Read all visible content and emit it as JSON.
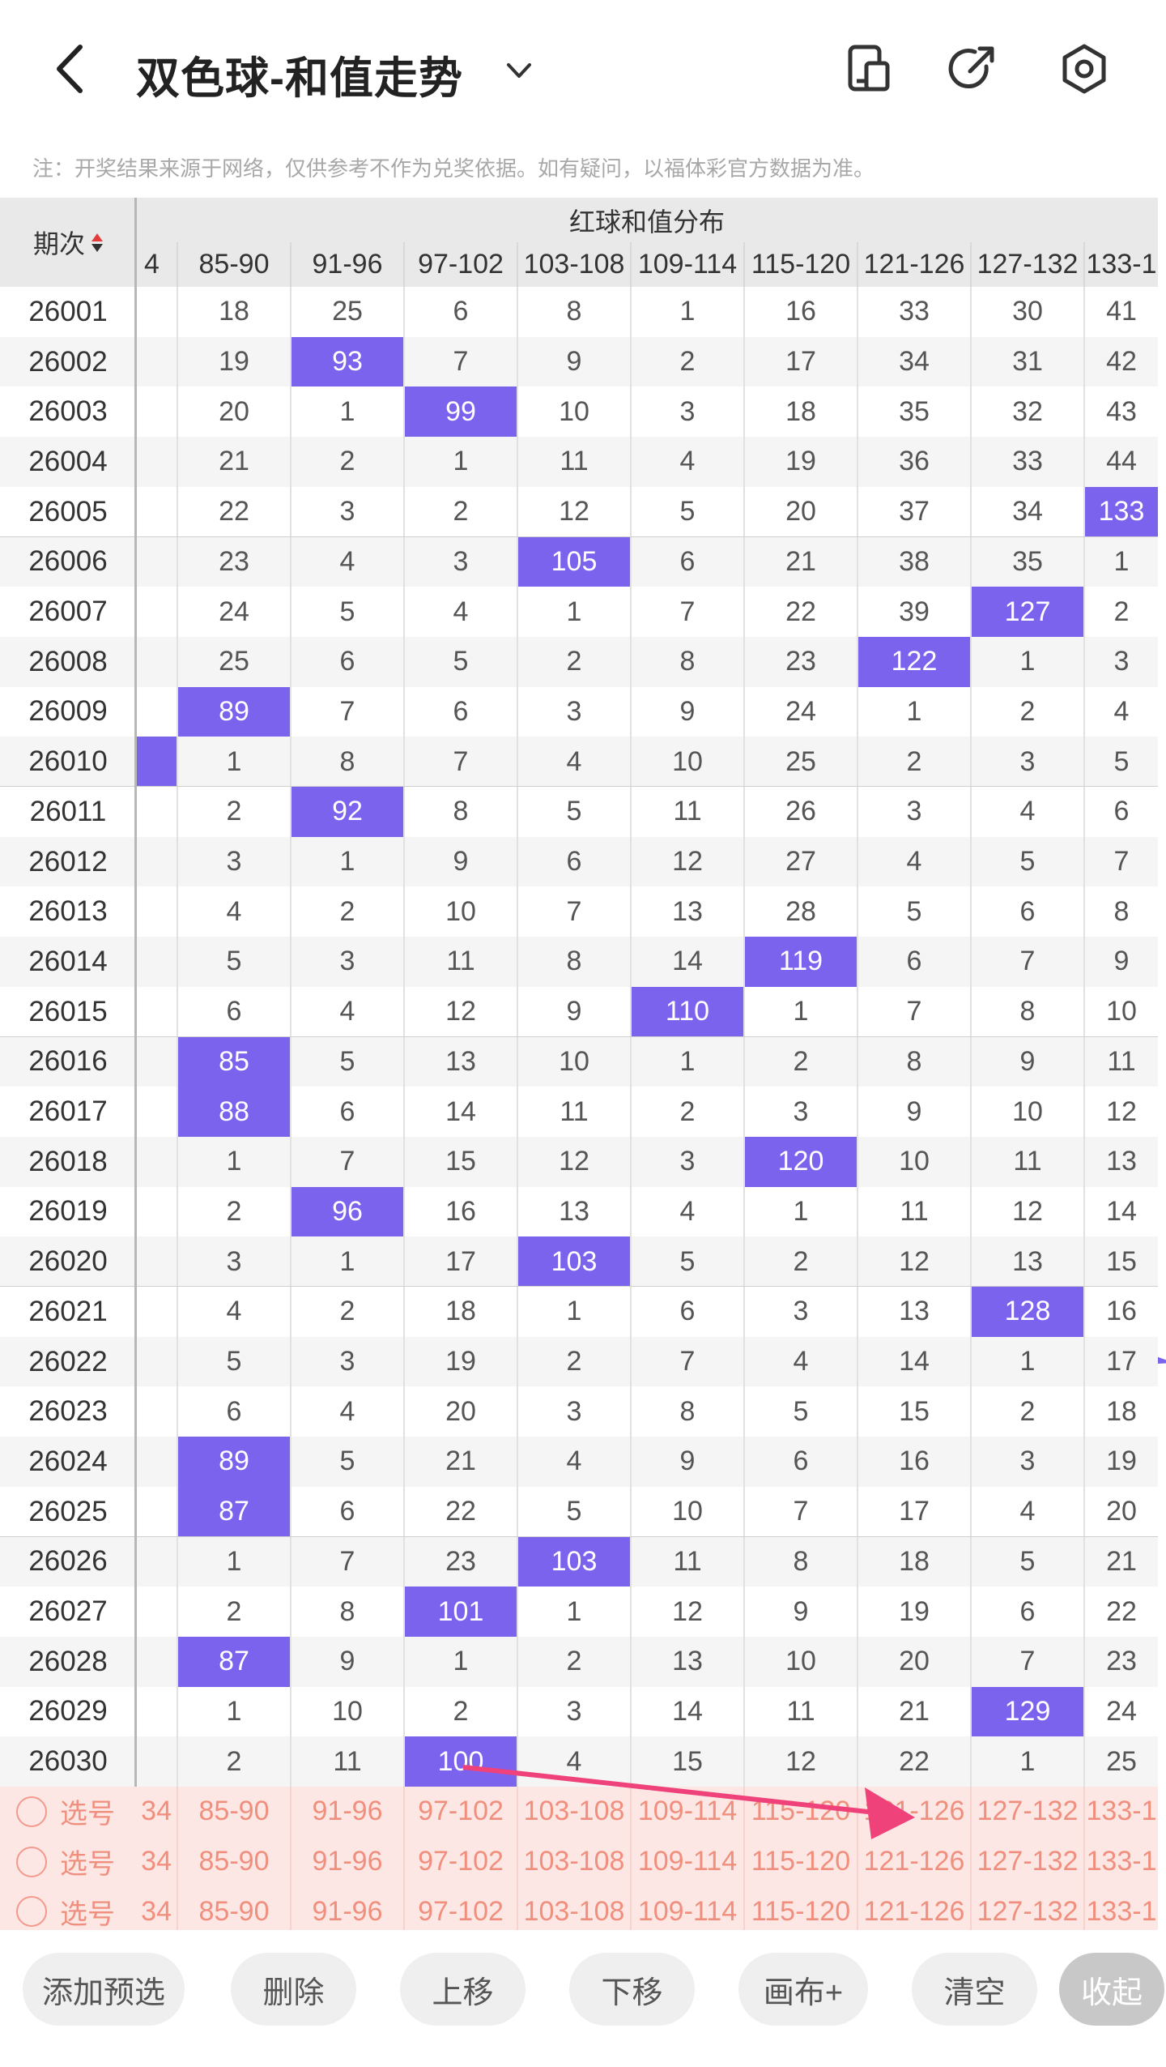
{
  "header": {
    "title": "双色球-和值走势",
    "back_icon": "back-chevron-icon",
    "caret_icon": "chevron-down-icon",
    "icons": [
      "phone-layout-icon",
      "share-icon",
      "settings-icon"
    ]
  },
  "notice": "注：开奖结果来源于网络，仅供参考不作为兑奖依据。如有疑问，以福体彩官方数据为准。",
  "table": {
    "period_header": "期次",
    "group_title": "红球和值分布",
    "columns": [
      "4",
      "85-90",
      "91-96",
      "97-102",
      "103-108",
      "109-114",
      "115-120",
      "121-126",
      "127-132",
      "133-1"
    ],
    "rows": [
      {
        "period": "26001",
        "cells": [
          "",
          "18",
          "25",
          "6",
          "8",
          "1",
          "16",
          "33",
          "30",
          "41"
        ]
      },
      {
        "period": "26002",
        "cells": [
          "",
          "19",
          "93",
          "7",
          "9",
          "2",
          "17",
          "34",
          "31",
          "42"
        ]
      },
      {
        "period": "26003",
        "cells": [
          "",
          "20",
          "1",
          "99",
          "10",
          "3",
          "18",
          "35",
          "32",
          "43"
        ]
      },
      {
        "period": "26004",
        "cells": [
          "",
          "21",
          "2",
          "1",
          "11",
          "4",
          "19",
          "36",
          "33",
          "44"
        ]
      },
      {
        "period": "26005",
        "cells": [
          "",
          "22",
          "3",
          "2",
          "12",
          "5",
          "20",
          "37",
          "34",
          "133"
        ]
      },
      {
        "period": "26006",
        "cells": [
          "",
          "23",
          "4",
          "3",
          "105",
          "6",
          "21",
          "38",
          "35",
          "1"
        ]
      },
      {
        "period": "26007",
        "cells": [
          "",
          "24",
          "5",
          "4",
          "1",
          "7",
          "22",
          "39",
          "127",
          "2"
        ]
      },
      {
        "period": "26008",
        "cells": [
          "",
          "25",
          "6",
          "5",
          "2",
          "8",
          "23",
          "122",
          "1",
          "3"
        ]
      },
      {
        "period": "26009",
        "cells": [
          "",
          "89",
          "7",
          "6",
          "3",
          "9",
          "24",
          "1",
          "2",
          "4"
        ]
      },
      {
        "period": "26010",
        "cells": [
          "",
          "1",
          "8",
          "7",
          "4",
          "10",
          "25",
          "2",
          "3",
          "5"
        ]
      },
      {
        "period": "26011",
        "cells": [
          "",
          "2",
          "92",
          "8",
          "5",
          "11",
          "26",
          "3",
          "4",
          "6"
        ]
      },
      {
        "period": "26012",
        "cells": [
          "",
          "3",
          "1",
          "9",
          "6",
          "12",
          "27",
          "4",
          "5",
          "7"
        ]
      },
      {
        "period": "26013",
        "cells": [
          "",
          "4",
          "2",
          "10",
          "7",
          "13",
          "28",
          "5",
          "6",
          "8"
        ]
      },
      {
        "period": "26014",
        "cells": [
          "",
          "5",
          "3",
          "11",
          "8",
          "14",
          "119",
          "6",
          "7",
          "9"
        ]
      },
      {
        "period": "26015",
        "cells": [
          "",
          "6",
          "4",
          "12",
          "9",
          "110",
          "1",
          "7",
          "8",
          "10"
        ]
      },
      {
        "period": "26016",
        "cells": [
          "",
          "85",
          "5",
          "13",
          "10",
          "1",
          "2",
          "8",
          "9",
          "11"
        ]
      },
      {
        "period": "26017",
        "cells": [
          "",
          "88",
          "6",
          "14",
          "11",
          "2",
          "3",
          "9",
          "10",
          "12"
        ]
      },
      {
        "period": "26018",
        "cells": [
          "",
          "1",
          "7",
          "15",
          "12",
          "3",
          "120",
          "10",
          "11",
          "13"
        ]
      },
      {
        "period": "26019",
        "cells": [
          "",
          "2",
          "96",
          "16",
          "13",
          "4",
          "1",
          "11",
          "12",
          "14"
        ]
      },
      {
        "period": "26020",
        "cells": [
          "",
          "3",
          "1",
          "17",
          "103",
          "5",
          "2",
          "12",
          "13",
          "15"
        ]
      },
      {
        "period": "26021",
        "cells": [
          "",
          "4",
          "2",
          "18",
          "1",
          "6",
          "3",
          "13",
          "128",
          "16"
        ]
      },
      {
        "period": "26022",
        "cells": [
          "",
          "5",
          "3",
          "19",
          "2",
          "7",
          "4",
          "14",
          "1",
          "17"
        ]
      },
      {
        "period": "26023",
        "cells": [
          "",
          "6",
          "4",
          "20",
          "3",
          "8",
          "5",
          "15",
          "2",
          "18"
        ]
      },
      {
        "period": "26024",
        "cells": [
          "",
          "89",
          "5",
          "21",
          "4",
          "9",
          "6",
          "16",
          "3",
          "19"
        ]
      },
      {
        "period": "26025",
        "cells": [
          "",
          "87",
          "6",
          "22",
          "5",
          "10",
          "7",
          "17",
          "4",
          "20"
        ]
      },
      {
        "period": "26026",
        "cells": [
          "",
          "1",
          "7",
          "23",
          "103",
          "11",
          "8",
          "18",
          "5",
          "21"
        ]
      },
      {
        "period": "26027",
        "cells": [
          "",
          "2",
          "8",
          "101",
          "1",
          "12",
          "9",
          "19",
          "6",
          "22"
        ]
      },
      {
        "period": "26028",
        "cells": [
          "",
          "87",
          "9",
          "1",
          "2",
          "13",
          "10",
          "20",
          "7",
          "23"
        ]
      },
      {
        "period": "26029",
        "cells": [
          "",
          "1",
          "10",
          "2",
          "3",
          "14",
          "11",
          "21",
          "129",
          "24"
        ]
      },
      {
        "period": "26030",
        "cells": [
          "",
          "2",
          "11",
          "100",
          "4",
          "15",
          "12",
          "22",
          "1",
          "25"
        ]
      }
    ],
    "hits": [
      [
        1,
        2
      ],
      [
        2,
        3
      ],
      [
        4,
        9
      ],
      [
        5,
        4
      ],
      [
        6,
        8
      ],
      [
        7,
        7
      ],
      [
        8,
        1
      ],
      [
        9,
        0
      ],
      [
        10,
        2
      ],
      [
        13,
        6
      ],
      [
        14,
        5
      ],
      [
        15,
        1
      ],
      [
        16,
        1
      ],
      [
        17,
        6
      ],
      [
        18,
        2
      ],
      [
        19,
        4
      ],
      [
        20,
        8
      ],
      [
        23,
        1
      ],
      [
        24,
        1
      ],
      [
        25,
        4
      ],
      [
        26,
        3
      ],
      [
        27,
        1
      ],
      [
        28,
        8
      ],
      [
        29,
        3
      ]
    ],
    "select_label": "选号",
    "select_columns": [
      "34",
      "85-90",
      "91-96",
      "97-102",
      "103-108",
      "109-114",
      "115-120",
      "121-126",
      "127-132",
      "133-1"
    ]
  },
  "toolbar": {
    "buttons": [
      "添加预选",
      "删除",
      "上移",
      "下移",
      "画布+",
      "清空",
      "收起"
    ]
  },
  "colors": {
    "hit": "#7b63ee",
    "line": "#7b63ee",
    "arrow": "#f0427a",
    "select_bg": "#fde7e4",
    "select_text": "#f08f7e"
  }
}
